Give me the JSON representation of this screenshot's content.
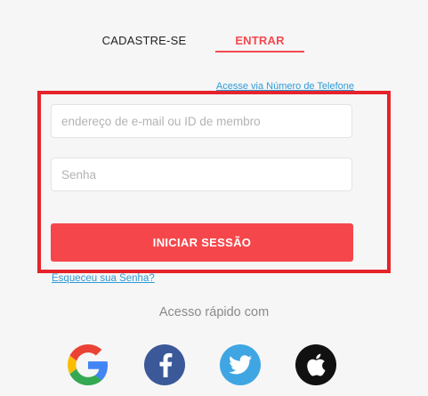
{
  "tabs": {
    "signup_label": "CADASTRE-SE",
    "login_label": "ENTRAR"
  },
  "phone_link": "Acesse via Número de Telefone",
  "form": {
    "email_placeholder": "endereço de e-mail ou ID de membro",
    "password_placeholder": "Senha",
    "submit_label": "INICIAR SESSÃO"
  },
  "forgot_link": "Esqueceu sua Senha?",
  "quick_access_label": "Acesso rápido com",
  "social_icons": [
    "google-icon",
    "facebook-icon",
    "twitter-icon",
    "apple-icon"
  ],
  "colors": {
    "accent": "#f5474b",
    "link": "#2f9bd6",
    "highlight_border": "#e5232b"
  }
}
